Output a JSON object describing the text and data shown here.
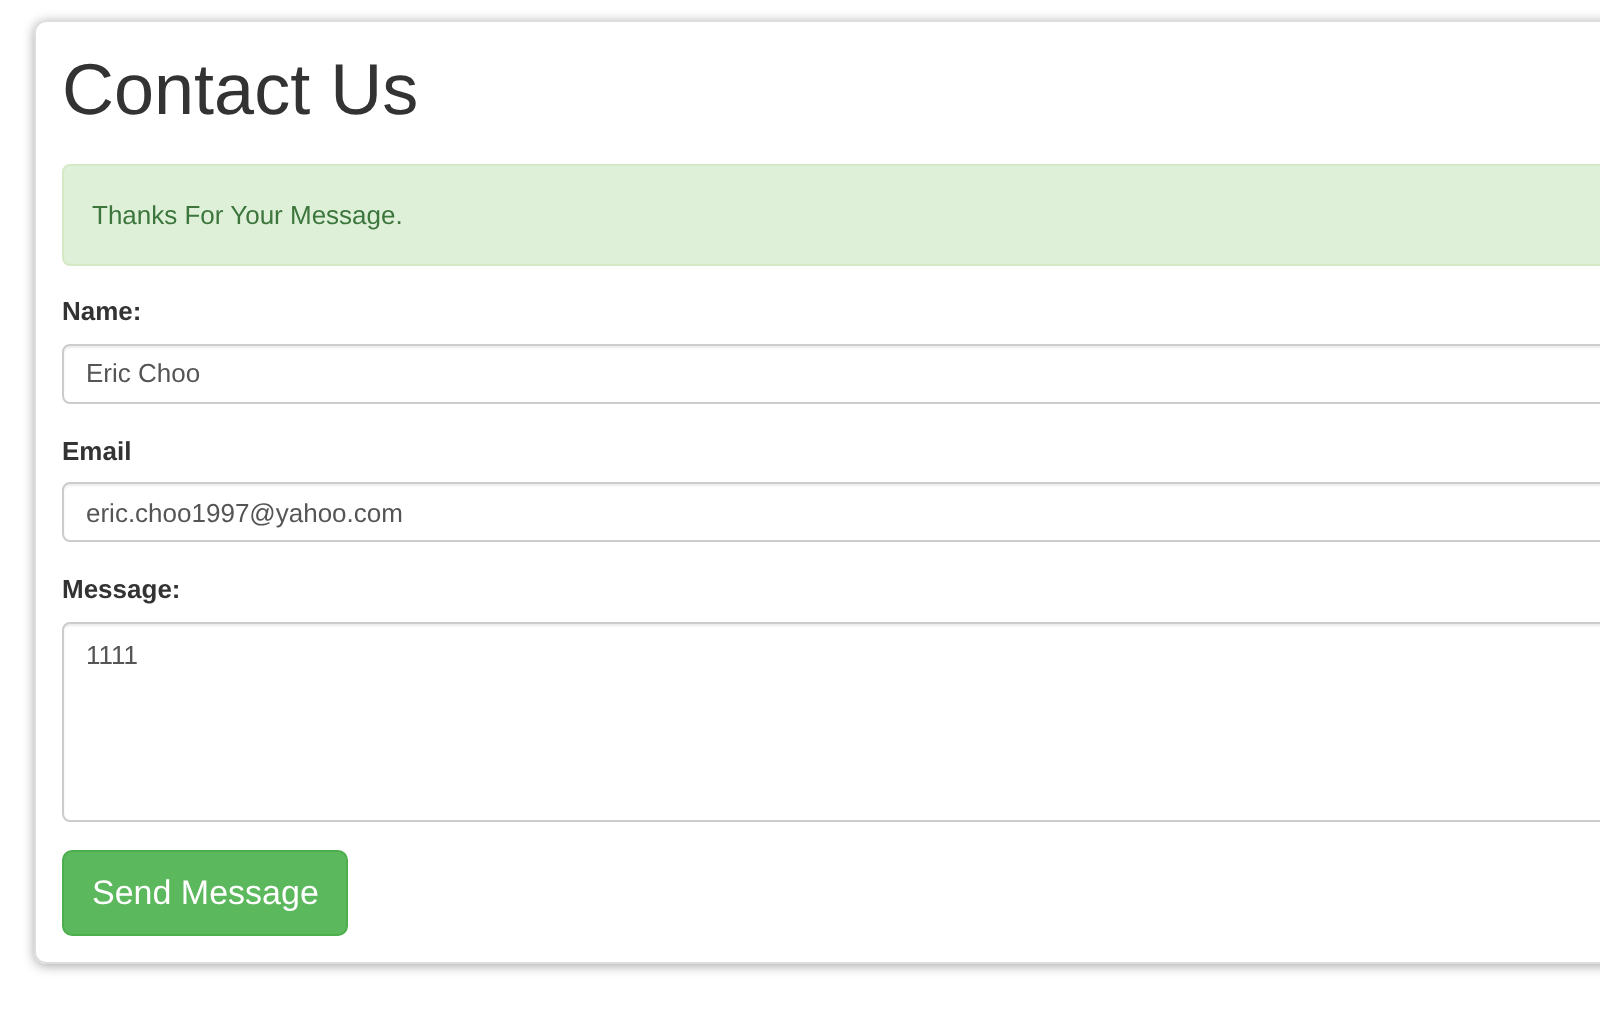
{
  "title": "Contact Us",
  "alert": {
    "text": "Thanks For Your Message."
  },
  "fields": [
    {
      "kind": "input",
      "label": "Name:",
      "value": "Eric Choo"
    },
    {
      "kind": "input",
      "label": "Email",
      "value": "eric.choo1997@yahoo.com"
    },
    {
      "kind": "textarea",
      "label": "Message:",
      "value": "1111"
    }
  ],
  "button": "Send Message"
}
